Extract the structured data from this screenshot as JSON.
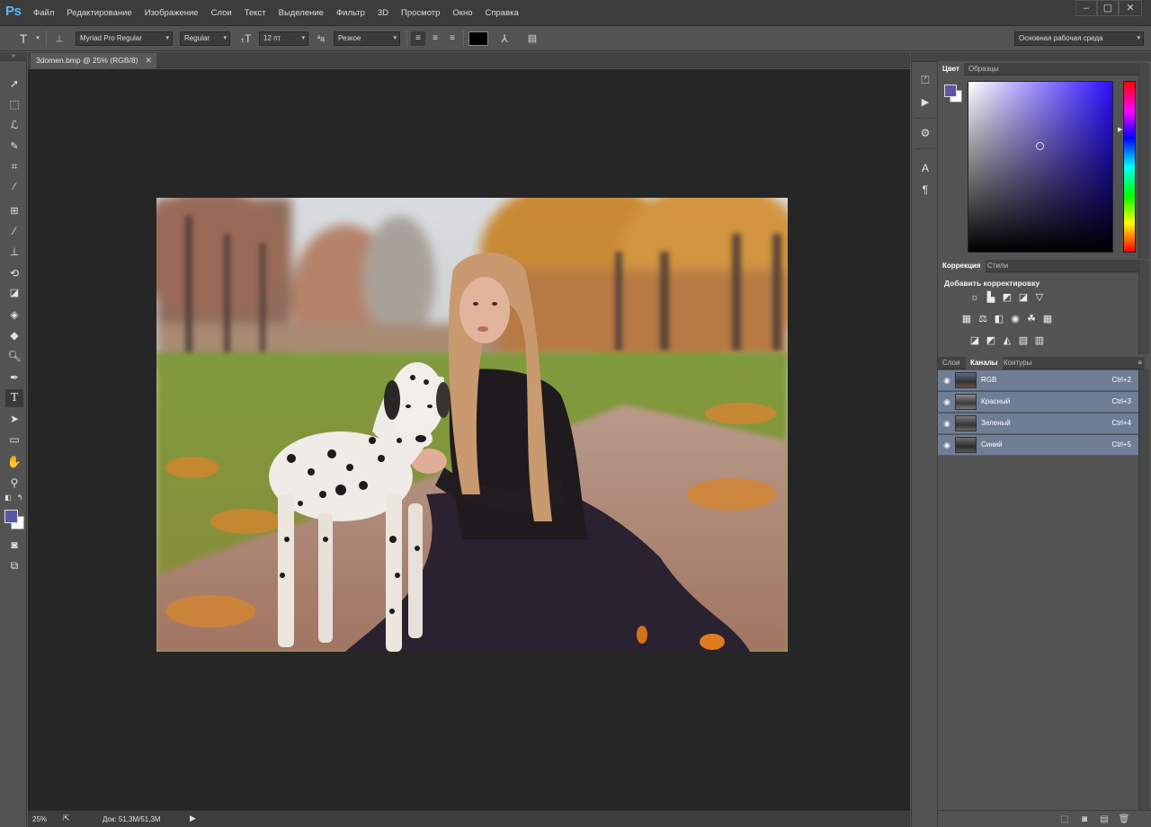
{
  "app": {
    "logo": "Ps"
  },
  "menu": [
    "Файл",
    "Редактирование",
    "Изображение",
    "Слои",
    "Текст",
    "Выделение",
    "Фильтр",
    "3D",
    "Просмотр",
    "Окно",
    "Справка"
  ],
  "window_controls": {
    "minimize": "–",
    "maximize": "▢",
    "close": "✕"
  },
  "options": {
    "font_family": "Myriad Pro Regular",
    "font_style": "Regular",
    "font_size": "12 пт",
    "aa_label": "ªa",
    "antialias": "Резкое",
    "text_color": "#000000",
    "workspace": "Основная рабочая среда"
  },
  "document": {
    "tab_title": "3domen.bmp @ 25% (RGB/8)",
    "zoom": "25%",
    "doc_info": "Док: 51,3M/51,3M"
  },
  "tools": [
    "move-tool-icon",
    "marquee-tool-icon",
    "lasso-tool-icon",
    "quick-selection-tool-icon",
    "crop-tool-icon",
    "eyedropper-tool-icon",
    "healing-brush-tool-icon",
    "brush-tool-icon",
    "clone-stamp-tool-icon",
    "history-brush-tool-icon",
    "eraser-tool-icon",
    "paint-bucket-tool-icon",
    "blur-tool-icon",
    "dodge-tool-icon",
    "pen-tool-icon",
    "type-tool-icon",
    "path-selection-tool-icon",
    "rectangle-tool-icon",
    "hand-tool-icon",
    "zoom-tool-icon"
  ],
  "colors": {
    "foreground": "#5b55a3",
    "background": "#ffffff",
    "selected_row": "#6f7e95"
  },
  "color_panel": {
    "tabs": [
      "Цвет",
      "Образцы"
    ]
  },
  "adjustments_panel": {
    "tabs": [
      "Коррекция",
      "Стили"
    ],
    "title": "Добавить корректировку"
  },
  "channels_panel": {
    "tabs": [
      "Слои",
      "Каналы",
      "Контуры"
    ],
    "channels": [
      {
        "name": "RGB",
        "shortcut": "Ctrl+2"
      },
      {
        "name": "Красный",
        "shortcut": "Ctrl+3"
      },
      {
        "name": "Зеленый",
        "shortcut": "Ctrl+4"
      },
      {
        "name": "Синий",
        "shortcut": "Ctrl+5"
      }
    ]
  }
}
